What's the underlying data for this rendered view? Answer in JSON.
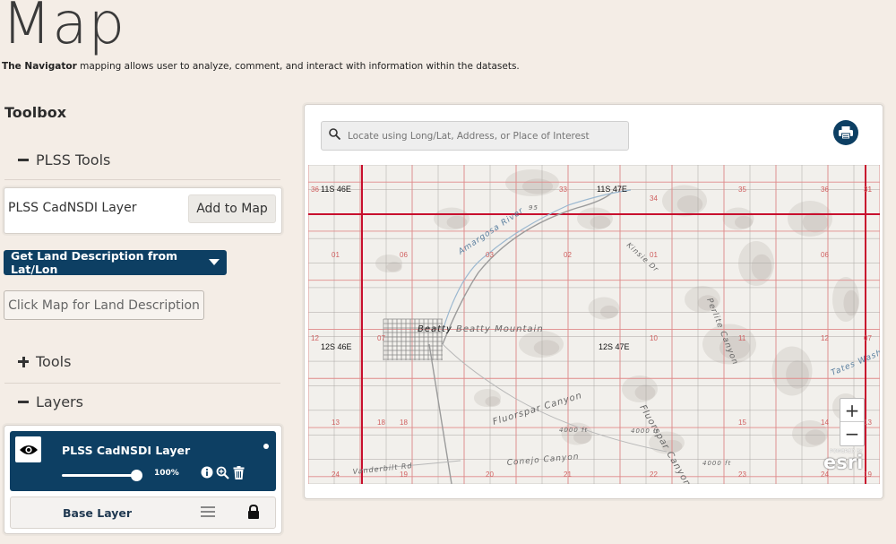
{
  "page": {
    "title": "Map",
    "intro_bold": "The Navigator",
    "intro_rest": " mapping allows user to analyze, comment, and interact with information within the datasets."
  },
  "toolbox": {
    "title": "Toolbox",
    "plss_tools_label": "PLSS Tools",
    "plss_layer_label": "PLSS CadNSDI Layer",
    "add_to_map_label": "Add to Map",
    "get_land_label": "Get Land Description from Lat/Lon",
    "click_map_label": "Click Map for Land Description",
    "tools_label": "Tools",
    "layers_label": "Layers"
  },
  "layers": {
    "active": {
      "name": "PLSS CadNSDI Layer",
      "opacity_pct": "100%",
      "opacity_fraction": 1.0
    },
    "base": {
      "name": "Base Layer"
    }
  },
  "map": {
    "search_placeholder": "Locate using Long/Lat, Address, or Place of Interest",
    "township_labels": [
      "11S 46E",
      "11S 47E",
      "12S 46E",
      "12S 47E"
    ],
    "section_numbers": [
      "36",
      "31",
      "33",
      "34",
      "35",
      "36",
      "31",
      "01",
      "06",
      "03",
      "02",
      "01",
      "06",
      "12",
      "07",
      "10",
      "11",
      "12",
      "07",
      "13",
      "18",
      "15",
      "14",
      "13",
      "18",
      "24",
      "19",
      "22",
      "23",
      "24",
      "19",
      "20",
      "21"
    ],
    "place_labels": [
      "Amargosa River",
      "Beatty",
      "Beatty Mountain",
      "Fluorspar Canyon",
      "Fluorspar Canyon",
      "Perlite Canyon",
      "Tates Wash",
      "Kinsie Dr",
      "Vanderbilt Rd",
      "Conejo Canyon",
      "4000 ft",
      "4000 ft",
      "4000 ft",
      "95"
    ],
    "zoom_in": "+",
    "zoom_out": "−",
    "attribution_prefix": "POWERED BY",
    "attribution": "esri"
  },
  "icons": {
    "search": "search-icon",
    "print": "printer-icon",
    "eye": "eye-icon",
    "info": "info-icon",
    "zoom_layer": "zoom-to-layer-icon",
    "trash": "trash-icon",
    "menu": "hamburger-menu-icon",
    "lock": "lock-icon"
  },
  "colors": {
    "accent": "#0d3f63",
    "background": "#f4ede6",
    "plss_red": "#c8102e"
  }
}
